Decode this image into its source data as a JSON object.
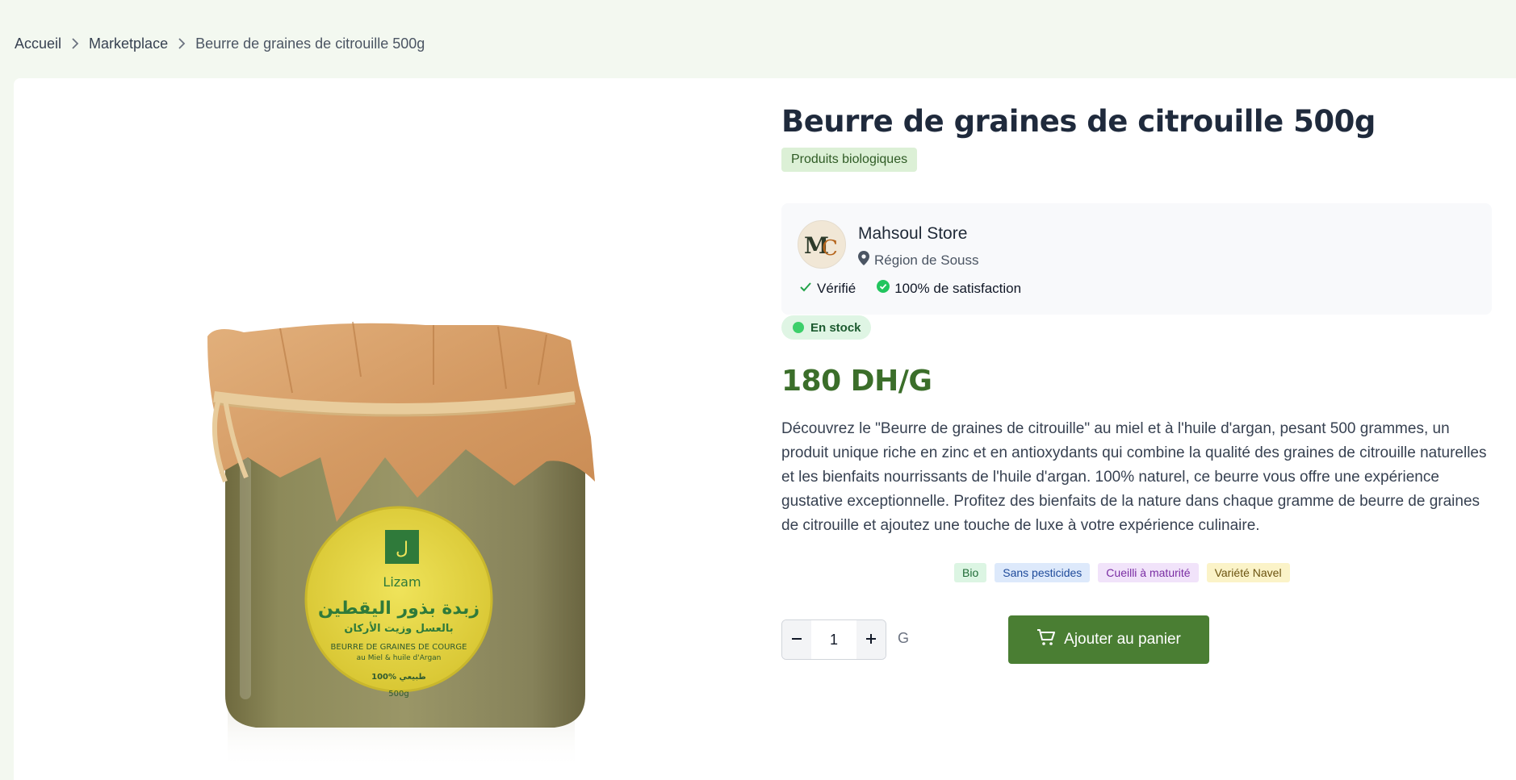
{
  "breadcrumb": {
    "items": [
      "Accueil",
      "Marketplace",
      "Beurre de graines de citrouille 500g"
    ]
  },
  "product": {
    "title": "Beurre de graines de citrouille 500g",
    "category": "Produits biologiques",
    "stock": "En stock",
    "price": "180 DH/G",
    "description": "Découvrez le \"Beurre de graines de citrouille\" au miel et à l'huile d'argan, pesant 500 grammes, un produit unique riche en zinc et en antioxydants qui combine la qualité des graines de citrouille naturelles et les bienfaits nourrissants de l'huile d'argan. 100% naturel, ce beurre vous offre une expérience gustative exceptionnelle. Profitez des bienfaits de la nature dans chaque gramme de beurre de graines de citrouille et ajoutez une touche de luxe à votre expérience culinaire.",
    "tags": [
      "Bio",
      "Sans pesticides",
      "Cueilli à maturité",
      "Variété Navel"
    ],
    "image": {
      "label_brand": "Lizam",
      "label_arabic_title": "زبدة بذور اليقطين",
      "label_arabic_sub": "بالعسل وزيت الأركان",
      "label_fr_title": "BEURRE DE GRAINES DE COURGE",
      "label_fr_sub": "au Miel & huile d'Argan",
      "label_natural": "100% طبيعي",
      "label_weight": "500g"
    }
  },
  "seller": {
    "name": "Mahsoul Store",
    "region": "Région de Souss",
    "verified": "Vérifié",
    "satisfaction": "100% de satisfaction",
    "avatar_initials": "MC"
  },
  "cart": {
    "quantity": "1",
    "unit": "G",
    "add_label": "Ajouter au panier"
  },
  "colors": {
    "brand_green": "#4a7e33",
    "price_green": "#3b6e2a",
    "page_bg": "#f3f8f0"
  },
  "icons": {
    "breadcrumb_sep": "chevron-right-icon",
    "location": "map-pin-icon",
    "verified": "check-icon",
    "satisfaction": "check-circle-icon",
    "minus": "minus-icon",
    "plus": "plus-icon",
    "cart": "shopping-cart-icon"
  }
}
